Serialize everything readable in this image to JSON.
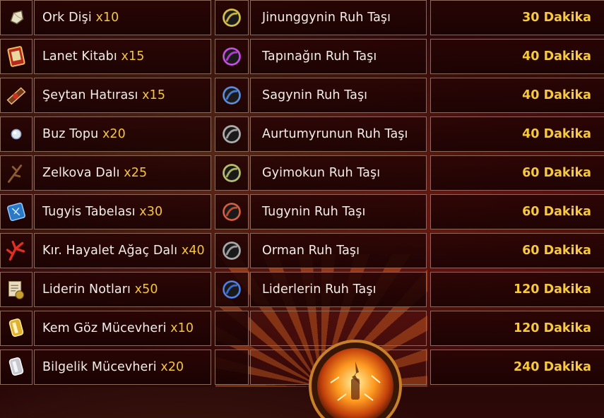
{
  "rows": [
    {
      "item": "Ork Dişi",
      "qty": "x10",
      "item_icon": "ork-tooth-icon",
      "stone": "Jinunggynin Ruh Taşı",
      "stone_icon": "gold-spirit-stone-icon",
      "stone_color": "#c8b23a",
      "time": "30 Dakika"
    },
    {
      "item": "Lanet Kitabı",
      "qty": "x15",
      "item_icon": "curse-book-icon",
      "stone": "Tapınağın Ruh Taşı",
      "stone_icon": "purple-spirit-stone-icon",
      "stone_color": "#b23ad0",
      "time": "40 Dakika"
    },
    {
      "item": "Şeytan Hatırası",
      "qty": "x15",
      "item_icon": "demon-memento-icon",
      "stone": "Sagynin Ruh Taşı",
      "stone_icon": "blue-spirit-stone-icon",
      "stone_color": "#4a78c8",
      "time": "40 Dakika"
    },
    {
      "item": "Buz Topu",
      "qty": "x20",
      "item_icon": "ice-ball-icon",
      "stone": "Aurtumyrunun Ruh Taşı",
      "stone_icon": "gray-spirit-stone-icon",
      "stone_color": "#a0a0a0",
      "time": "40 Dakika"
    },
    {
      "item": "Zelkova Dalı",
      "qty": "x25",
      "item_icon": "zelkova-branch-icon",
      "stone": "Gyimokun Ruh Taşı",
      "stone_icon": "olive-spirit-stone-icon",
      "stone_color": "#a9b060",
      "time": "60 Dakika"
    },
    {
      "item": "Tugyis Tabelası",
      "qty": "x30",
      "item_icon": "tugyis-tablet-icon",
      "stone": "Tugynin Ruh Taşı",
      "stone_icon": "red-spirit-stone-icon",
      "stone_color": "#c04a2a",
      "time": "60 Dakika"
    },
    {
      "item": "Kır. Hayalet Ağaç Dalı",
      "qty": "x40",
      "item_icon": "ghost-tree-branch-icon",
      "stone": "Orman Ruh Taşı",
      "stone_icon": "gray-spirit-stone-icon",
      "stone_color": "#9a9a9a",
      "time": "60 Dakika"
    },
    {
      "item": "Liderin Notları",
      "qty": "x50",
      "item_icon": "leader-notes-icon",
      "stone": "Liderlerin Ruh Taşı",
      "stone_icon": "blue-spirit-stone-icon",
      "stone_color": "#3a6ad0",
      "time": "120 Dakika"
    },
    {
      "item": "Kem Göz Mücevheri",
      "qty": "x10",
      "item_icon": "evil-eye-jewel-icon",
      "stone": "",
      "stone_icon": "",
      "stone_color": "",
      "time": "120 Dakika"
    },
    {
      "item": "Bilgelik Mücevheri",
      "qty": "x20",
      "item_icon": "wisdom-jewel-icon",
      "stone": "",
      "stone_icon": "",
      "stone_color": "",
      "time": "240 Dakika"
    }
  ],
  "colors": {
    "quantity": "#f5c53a",
    "time": "#f6c93e",
    "text": "#f4eee9",
    "border": "#8a6a5a"
  }
}
